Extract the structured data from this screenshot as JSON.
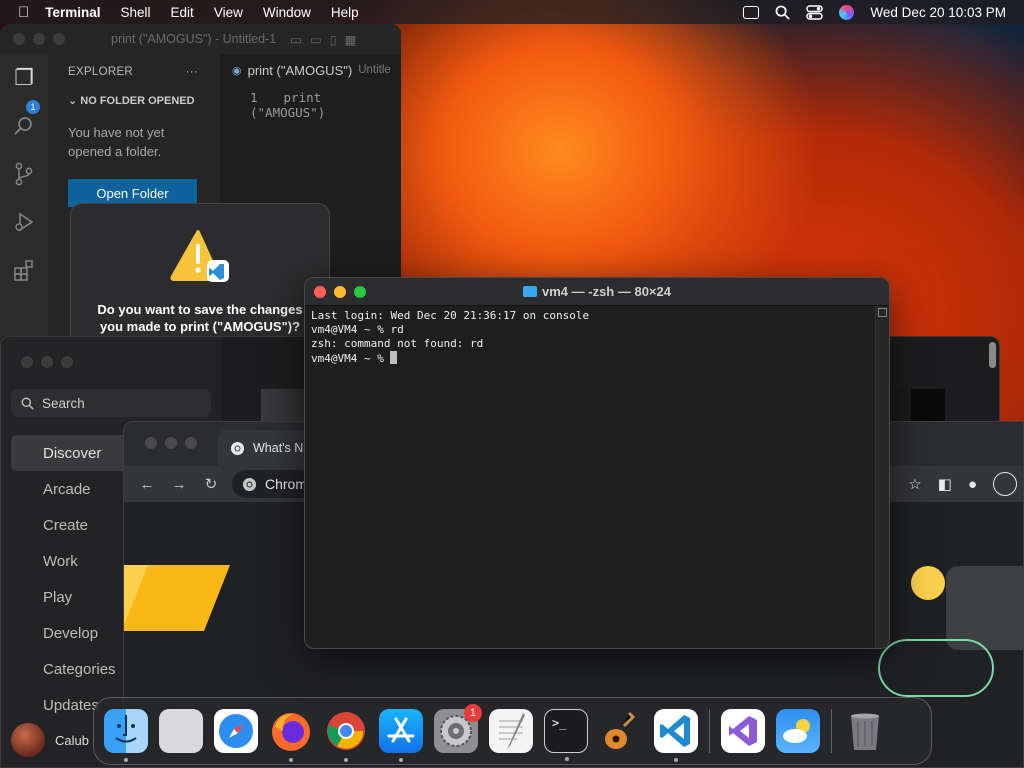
{
  "menubar": {
    "app": "Terminal",
    "menus": [
      "Shell",
      "Edit",
      "View",
      "Window",
      "Help"
    ],
    "clock": "Wed Dec 20  10:03 PM"
  },
  "vscode": {
    "title": "print (\"AMOGUS\") - Untitled-1",
    "badge": "1",
    "explorer_label": "EXPLORER",
    "explorer_more": "···",
    "no_folder": "NO FOLDER OPENED",
    "message": "You have not yet opened a folder.",
    "open_folder": "Open Folder",
    "tab_label": "print (\"AMOGUS\")",
    "tab_suffix": "Untitle",
    "line_number": "1",
    "code_line": "print (\"AMOGUS\")"
  },
  "save_dialog": {
    "question_line1": "Do you want to save the changes",
    "question_line2": "you made to print (\"AMOGUS\")?"
  },
  "appstore": {
    "search_placeholder": "Search",
    "nav": [
      "Discover",
      "Arcade",
      "Create",
      "Work",
      "Play",
      "Develop",
      "Categories",
      "Updates"
    ],
    "user": "Calub"
  },
  "chrome": {
    "tab_title": "What's N",
    "omnibox": "Chrom"
  },
  "terminal": {
    "title": "vm4 — -zsh — 80×24",
    "lines": [
      "Last login: Wed Dec 20 21:36:17 on console",
      "vm4@VM4 ~ % rd",
      "zsh: command not found: rd",
      "vm4@VM4 ~ % "
    ]
  },
  "dock": {
    "settings_badge": "1",
    "apps": [
      "finder-icon",
      "launchpad-icon",
      "safari-icon",
      "firefox-icon",
      "chrome-icon",
      "app-store-icon",
      "system-settings-icon",
      "textedit-icon",
      "terminal-icon",
      "garageband-icon",
      "vscode-icon",
      "visual-studio-icon",
      "weather-icon",
      "trash-icon"
    ]
  }
}
